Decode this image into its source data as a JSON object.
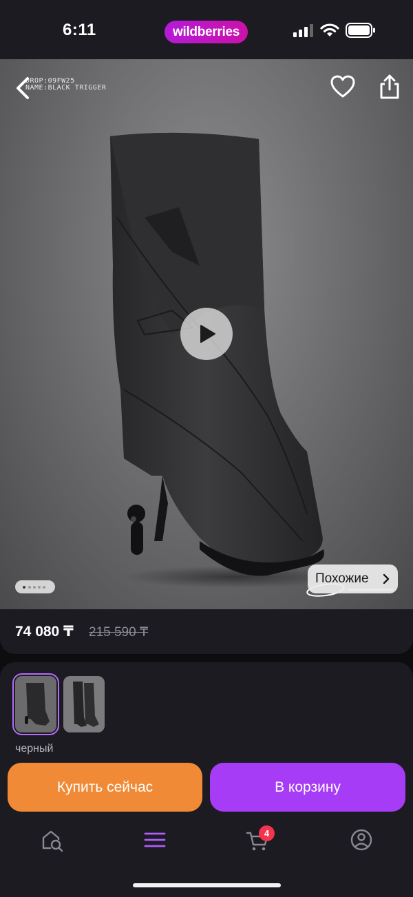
{
  "status_bar": {
    "time": "6:11",
    "brand": "wildberries",
    "icons": [
      "signal-icon",
      "wifi-icon",
      "battery-icon"
    ]
  },
  "media": {
    "overlay_lines": [
      "DROP:09FW25",
      "NAME:BLACK TRIGGER"
    ],
    "icons": [
      "back-arrow-icon",
      "heart-icon",
      "share-icon",
      "play-icon"
    ],
    "carousel_count": 5,
    "carousel_active": 1,
    "similar_label": "Похожие"
  },
  "price": {
    "current": "74 080 ₸",
    "old": "215 590 ₸"
  },
  "variants": {
    "thumbnails": 2,
    "selected_index": 0,
    "color_label": "черный"
  },
  "actions": {
    "buy_now": "Купить сейчас",
    "add_to_cart": "В корзину"
  },
  "tabbar": {
    "items": [
      "home-search-icon",
      "menu-icon",
      "cart-icon",
      "profile-icon"
    ],
    "active_index": 1,
    "cart_count": "4"
  },
  "colors": {
    "accent_purple": "#a63cf5",
    "buy_orange": "#f08a36",
    "badge_red": "#f4334f",
    "surface": "#1c1b21"
  }
}
